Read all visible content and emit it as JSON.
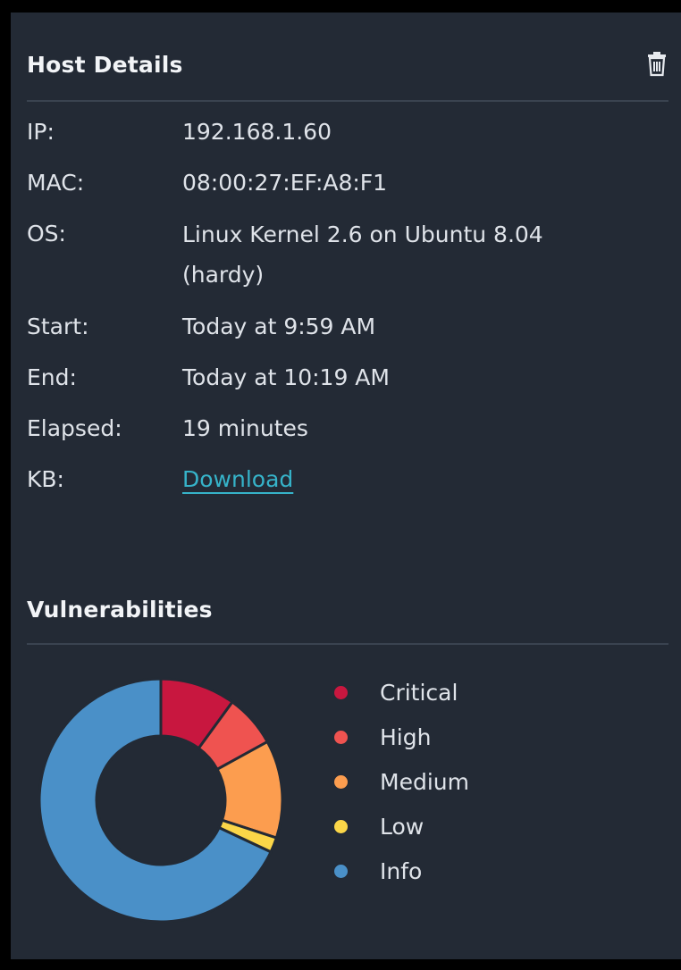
{
  "host_details": {
    "title": "Host Details",
    "delete_icon": "trash-icon",
    "rows": [
      {
        "label": "IP:",
        "value": "192.168.1.60"
      },
      {
        "label": "MAC:",
        "value": "08:00:27:EF:A8:F1"
      },
      {
        "label": "OS:",
        "value": "Linux Kernel 2.6 on Ubuntu 8.04 (hardy)"
      },
      {
        "label": "Start:",
        "value": "Today at 9:59 AM"
      },
      {
        "label": "End:",
        "value": "Today at 10:19 AM"
      },
      {
        "label": "Elapsed:",
        "value": "19 minutes"
      },
      {
        "label": "KB:",
        "value": "Download"
      }
    ]
  },
  "vulnerabilities": {
    "title": "Vulnerabilities"
  },
  "chart_data": {
    "type": "pie",
    "donut": true,
    "categories": [
      "Critical",
      "High",
      "Medium",
      "Low",
      "Info"
    ],
    "values": [
      10,
      7,
      13,
      2,
      68
    ],
    "colors": [
      "#c8173f",
      "#ef5350",
      "#fc9d4f",
      "#fbd648",
      "#4a90c8"
    ],
    "legend": "right"
  },
  "colors": {
    "background": "#232a35",
    "divider": "#3a4350",
    "link": "#36b3c9"
  }
}
